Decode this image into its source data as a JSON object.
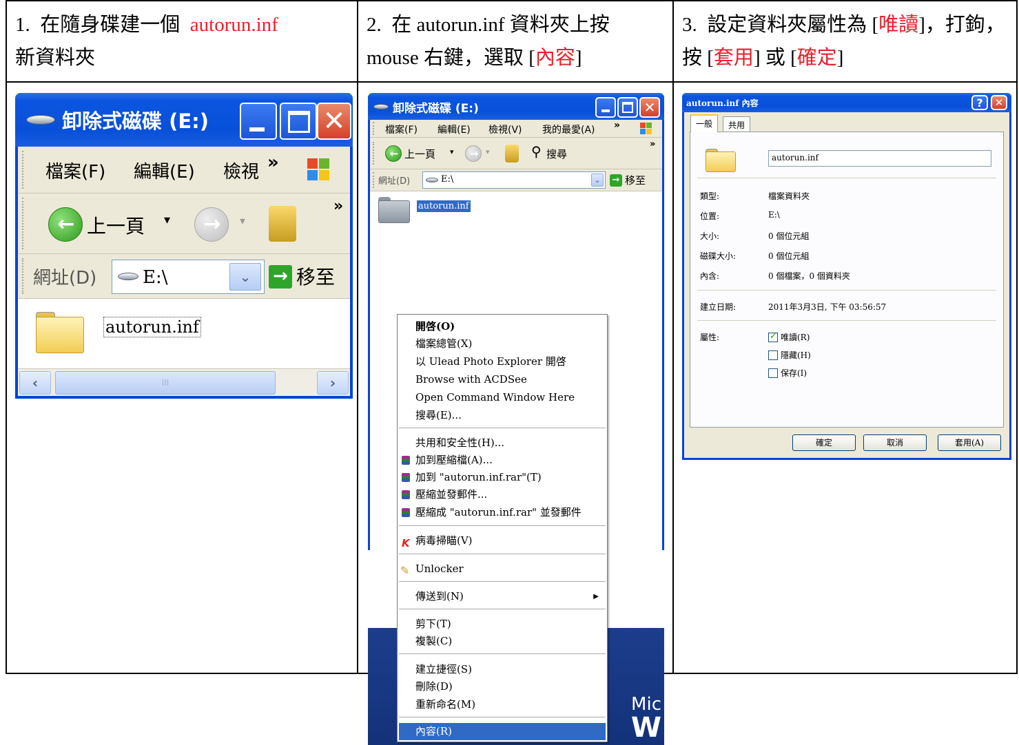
{
  "steps": [
    {
      "number": "1.",
      "text_before": "在隨身碟建一個",
      "highlight": "autorun.inf",
      "text_after": "新資料夾"
    },
    {
      "number": "2.",
      "text_before": "在 autorun.inf 資料夾上按 mouse 右鍵，選取 [",
      "highlight": "內容",
      "text_after": "]"
    },
    {
      "number": "3.",
      "text_before": "設定資料夾屬性為 [",
      "highlight_1": "唯讀",
      "text_mid_1": "]，打鉤，按 [",
      "highlight_2": "套用",
      "text_mid_2": "] 或 [",
      "highlight_3": "確定",
      "text_after": "]"
    }
  ],
  "colors": {
    "highlight_red": "#e8202a",
    "xp_title_blue": "#0850d8",
    "xp_close_red": "#d5402a",
    "selection_blue": "#316ac5"
  },
  "explorer_small": {
    "title": "卸除式磁碟 (E:)",
    "menu": [
      "檔案(F)",
      "編輯(E)",
      "檢視"
    ],
    "menu_overflow": "»",
    "back_label": "上一頁",
    "toolbar_overflow": "»",
    "address_label": "網址(D)",
    "address_value": "E:\\",
    "go_label": "移至",
    "folder_name": "autorun.inf",
    "scroll_thumb": "III"
  },
  "explorer_context": {
    "title": "卸除式磁碟 (E:)",
    "menu": [
      "檔案(F)",
      "編輯(E)",
      "檢視(V)",
      "我的最愛(A)"
    ],
    "menu_overflow": "»",
    "back_label": "上一頁",
    "search_label": "搜尋",
    "address_label": "網址(D)",
    "address_value": "E:\\",
    "go_label": "移至",
    "folder_name": "autorun.inf",
    "context_menu": [
      {
        "label": "開啓(O)",
        "bold": true
      },
      {
        "label": "檔案總管(X)"
      },
      {
        "label": "以 Ulead Photo Explorer 開啓"
      },
      {
        "label": "Browse with ACDSee"
      },
      {
        "label": "Open Command Window Here"
      },
      {
        "label": "搜尋(E)..."
      },
      {
        "label": "共用和安全性(H)..."
      },
      {
        "label": "加到壓縮檔(A)...",
        "icon": "winrar-icon"
      },
      {
        "label": "加到 \"autorun.inf.rar\"(T)",
        "icon": "winrar-icon"
      },
      {
        "label": "壓縮並發郵件...",
        "icon": "winrar-icon"
      },
      {
        "label": "壓縮成 \"autorun.inf.rar\" 並發郵件",
        "icon": "winrar-icon"
      },
      {
        "label": "病毒掃瞄(V)",
        "icon": "antivirus-icon"
      },
      {
        "label": "Unlocker",
        "icon": "unlocker-icon"
      },
      {
        "label": "傳送到(N)",
        "submenu": true
      },
      {
        "label": "剪下(T)"
      },
      {
        "label": "複製(C)"
      },
      {
        "label": "建立捷徑(S)"
      },
      {
        "label": "刪除(D)"
      },
      {
        "label": "重新命名(M)"
      },
      {
        "label": "內容(R)",
        "selected": true
      }
    ],
    "desktop_text_top": "Mic",
    "desktop_text_bottom": "W"
  },
  "properties": {
    "title": "autorun.inf 內容",
    "help_glyph": "?",
    "tabs": [
      "一般",
      "共用"
    ],
    "name_value": "autorun.inf",
    "rows": [
      {
        "label": "類型:",
        "value": "檔案資料夾"
      },
      {
        "label": "位置:",
        "value": "E:\\"
      },
      {
        "label": "大小:",
        "value": "0 個位元組"
      },
      {
        "label": "磁碟大小:",
        "value": "0 個位元組"
      },
      {
        "label": "內含:",
        "value": "0 個檔案，0 個資料夾"
      }
    ],
    "created_label": "建立日期:",
    "created_value": "2011年3月3日, 下午 03:56:57",
    "attributes_label": "屬性:",
    "attributes": [
      {
        "label": "唯讀(R)",
        "checked": true
      },
      {
        "label": "隱藏(H)",
        "checked": false
      },
      {
        "label": "保存(I)",
        "checked": false
      }
    ],
    "buttons": {
      "ok": "確定",
      "cancel": "取消",
      "apply": "套用(A)"
    }
  }
}
